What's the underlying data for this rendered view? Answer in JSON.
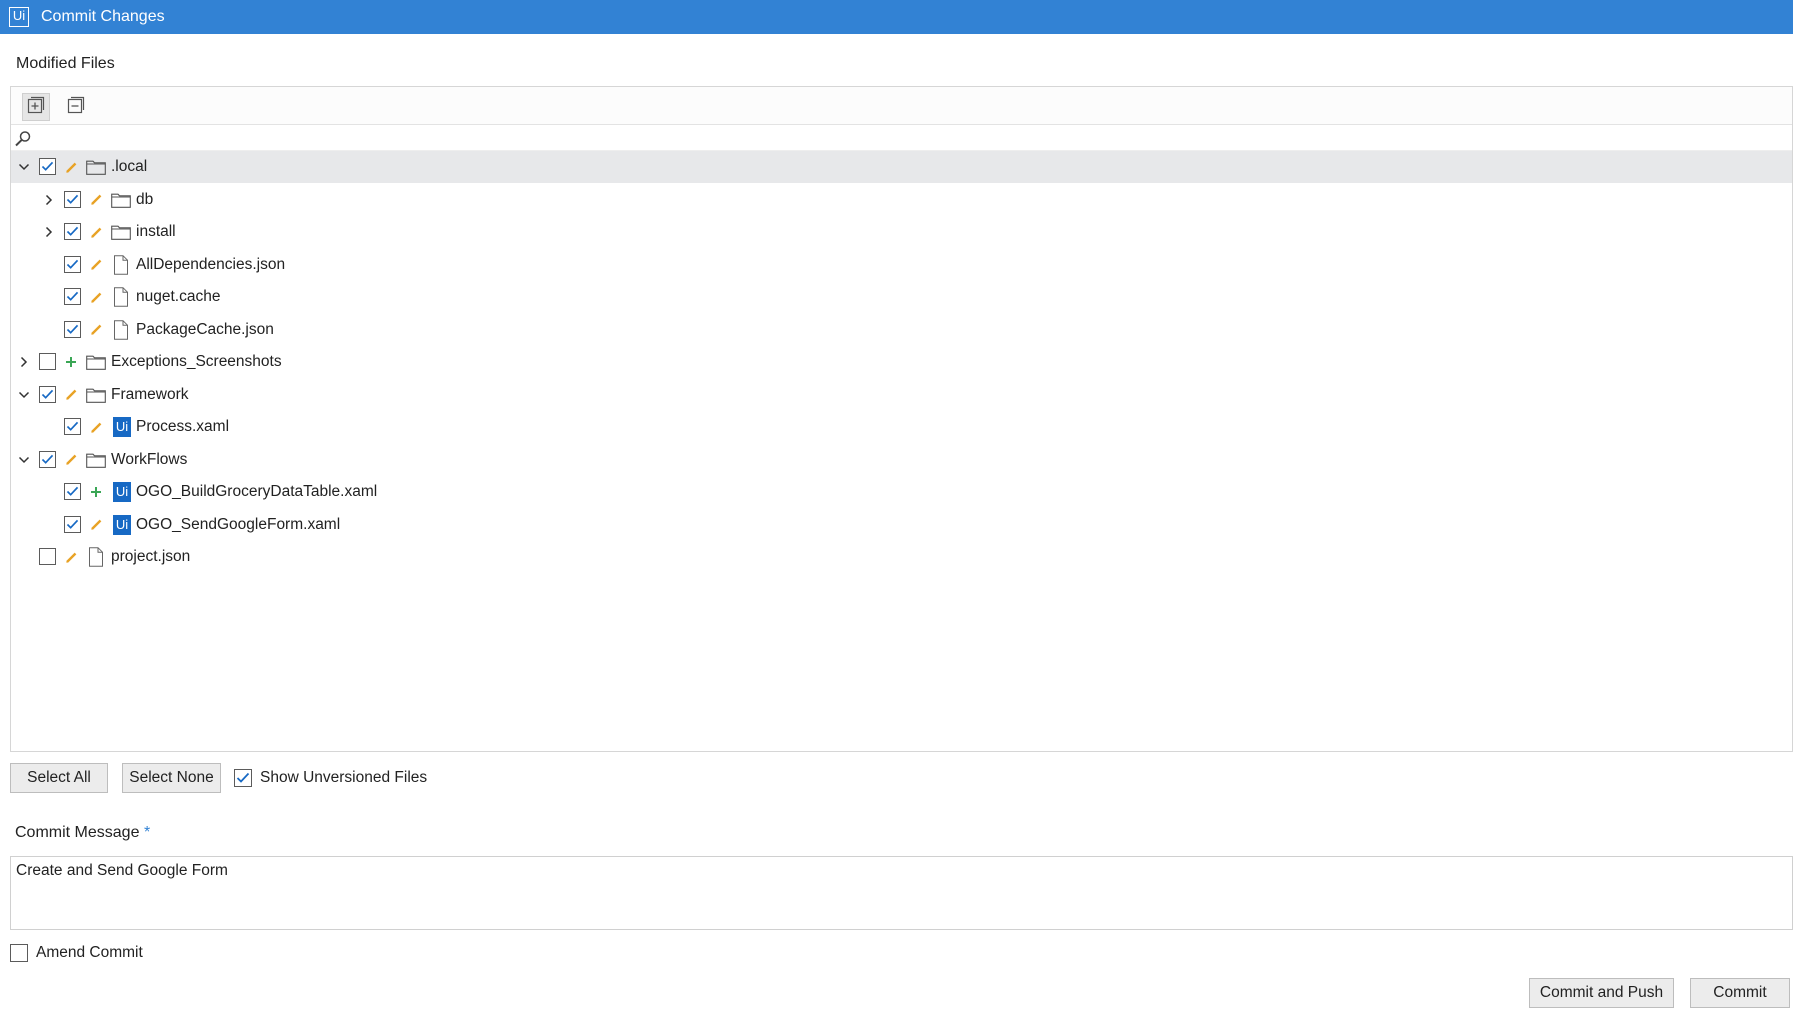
{
  "window": {
    "logo_text": "Ui",
    "title": "Commit Changes"
  },
  "modified_files": {
    "label": "Modified Files",
    "toolbar": {
      "expand_icon": "expand-all-icon",
      "collapse_icon": "collapse-all-icon"
    },
    "search": {
      "placeholder": "",
      "icon": "search-icon"
    },
    "tree": [
      {
        "name": ".local",
        "type": "folder",
        "expand": "expanded",
        "checked": true,
        "status": "modified",
        "level": 0,
        "selected": true
      },
      {
        "name": "db",
        "type": "folder",
        "expand": "collapsed",
        "checked": true,
        "status": "modified",
        "level": 1
      },
      {
        "name": "install",
        "type": "folder",
        "expand": "collapsed",
        "checked": true,
        "status": "modified",
        "level": 1
      },
      {
        "name": "AllDependencies.json",
        "type": "file",
        "expand": "none",
        "checked": true,
        "status": "modified",
        "level": 1
      },
      {
        "name": "nuget.cache",
        "type": "file",
        "expand": "none",
        "checked": true,
        "status": "modified",
        "level": 1
      },
      {
        "name": "PackageCache.json",
        "type": "file",
        "expand": "none",
        "checked": true,
        "status": "modified",
        "level": 1
      },
      {
        "name": "Exceptions_Screenshots",
        "type": "folder",
        "expand": "collapsed",
        "checked": false,
        "status": "added",
        "level": 0
      },
      {
        "name": "Framework",
        "type": "folder",
        "expand": "expanded",
        "checked": true,
        "status": "modified",
        "level": 0
      },
      {
        "name": "Process.xaml",
        "type": "uipath",
        "expand": "none",
        "checked": true,
        "status": "modified",
        "level": 1
      },
      {
        "name": "WorkFlows",
        "type": "folder",
        "expand": "expanded",
        "checked": true,
        "status": "modified",
        "level": 0
      },
      {
        "name": "OGO_BuildGroceryDataTable.xaml",
        "type": "uipath",
        "expand": "none",
        "checked": true,
        "status": "added",
        "level": 1
      },
      {
        "name": "OGO_SendGoogleForm.xaml",
        "type": "uipath",
        "expand": "none",
        "checked": true,
        "status": "modified",
        "level": 1
      },
      {
        "name": "project.json",
        "type": "file",
        "expand": "none",
        "checked": false,
        "status": "modified",
        "level": 0
      }
    ],
    "ui_badge_text": "Ui"
  },
  "actions": {
    "select_all": "Select All",
    "select_none": "Select None",
    "show_unversioned": {
      "label": "Show Unversioned Files",
      "checked": true
    }
  },
  "commit_message": {
    "label": "Commit Message",
    "required_marker": "*",
    "value": "Create and Send Google Form"
  },
  "amend_commit": {
    "label": "Amend Commit",
    "checked": false
  },
  "footer": {
    "commit_and_push": "Commit and Push",
    "commit": "Commit"
  },
  "colors": {
    "titlebar": "#3282d4",
    "modified": "#e8a225",
    "added": "#3aa655",
    "checkbox_check": "#1769c4",
    "uipath_badge": "#1769c4",
    "selected_row": "#e7e8ea"
  }
}
